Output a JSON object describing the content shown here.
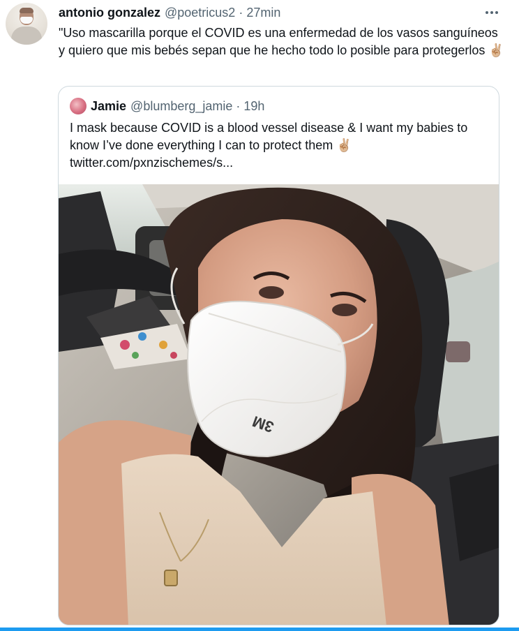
{
  "tweet": {
    "author_name": "antonio gonzalez",
    "author_handle": "@poetricus2",
    "separator": "·",
    "time": "27min",
    "text": "\"Uso mascarilla porque el COVID es una enfermedad de los vasos sanguíneos y quiero que mis bebés sepan que he hecho todo lo posible para protegerlos ✌🏼"
  },
  "quoted": {
    "author_name": "Jamie",
    "author_handle": "@blumberg_jamie",
    "separator": "·",
    "time": "19h",
    "text": "I mask because COVID is a blood vessel disease & I want my babies to know I’ve done everything I can to protect them ✌🏼",
    "link": "twitter.com/pxnzischemes/s...",
    "photo_mask_print": "3M"
  },
  "icons": {
    "more": "more-horizontal-icon"
  },
  "colors": {
    "name": "#0f1419",
    "secondary": "#536471",
    "border": "#cfd9de",
    "accent": "#1d9bf0"
  }
}
